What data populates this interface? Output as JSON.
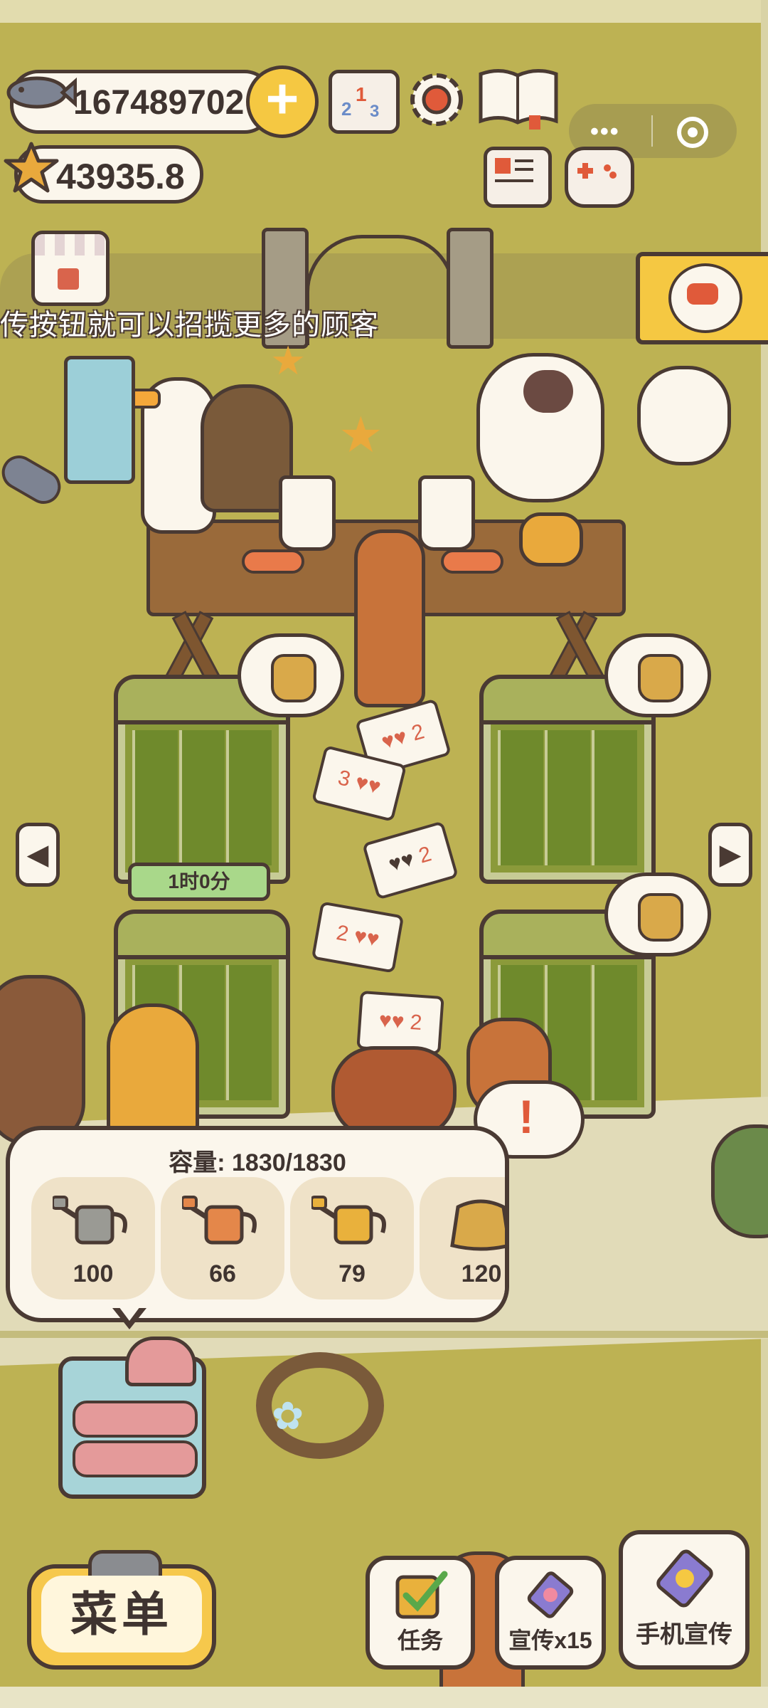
{
  "hud": {
    "fish_count": "167489702",
    "star_count": "43935.8"
  },
  "banner_text": "传按钮就可以招揽更多的顾客",
  "timer_label": "1时0分",
  "cards": [
    "2",
    "3",
    "2",
    "2",
    "2"
  ],
  "inventory": {
    "capacity_label": "容量: 1830/1830",
    "items": [
      {
        "name": "grey-watering-can",
        "qty": "100",
        "color": "#9a9a94"
      },
      {
        "name": "orange-watering-can",
        "qty": "66",
        "color": "#e4874a"
      },
      {
        "name": "yellow-watering-can",
        "qty": "79",
        "color": "#e9b13c"
      },
      {
        "name": "seed-sack",
        "qty": "120",
        "color": "#d9a94a"
      }
    ]
  },
  "bottom_buttons": {
    "menu_label": "菜单",
    "task_label": "任务",
    "promote_label": "宣传x15",
    "phone_promote_label": "手机宣传"
  },
  "colors": {
    "grass": "#bdb253",
    "outline": "#4a3a33",
    "accent_yellow": "#f5c842",
    "panel_bg": "#fbf6ec"
  }
}
